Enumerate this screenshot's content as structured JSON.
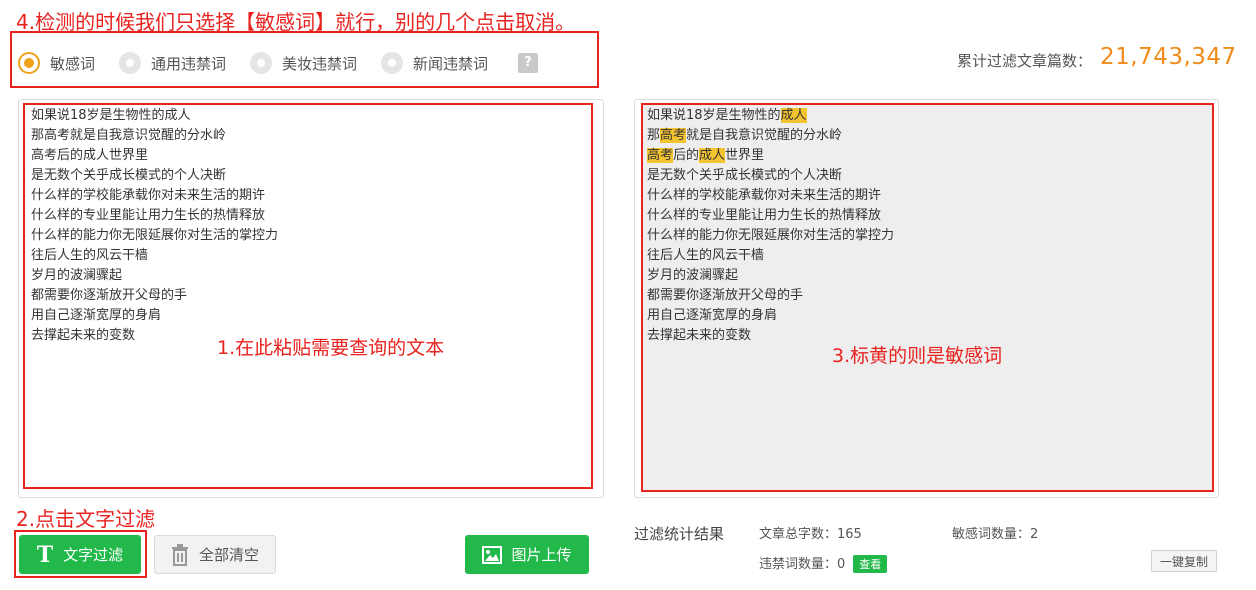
{
  "annotations": {
    "step4": "4.检测的时候我们只选择【敏感词】就行，别的几个点击取消。",
    "step1": "1.在此粘贴需要查询的文本",
    "step2": "2.点击文字过滤",
    "step3": "3.标黄的则是敏感词"
  },
  "options": [
    {
      "label": "敏感词",
      "selected": true
    },
    {
      "label": "通用违禁词",
      "selected": false
    },
    {
      "label": "美妆违禁词",
      "selected": false
    },
    {
      "label": "新闻违禁词",
      "selected": false
    }
  ],
  "help_label": "?",
  "counter": {
    "label": "累计过滤文章篇数：",
    "value": "21,743,347"
  },
  "input_lines": [
    "如果说18岁是生物性的成人",
    "那高考就是自我意识觉醒的分水岭",
    "高考后的成人世界里",
    "是无数个关乎成长模式的个人决断",
    "什么样的学校能承载你对未来生活的期许",
    "什么样的专业里能让用力生长的热情释放",
    "什么样的能力你无限延展你对生活的掌控力",
    "往后人生的风云干樯",
    "岁月的波澜骤起",
    "都需要你逐渐放开父母的手",
    "用自己逐渐宽厚的身肩",
    "去撑起未来的变数"
  ],
  "output_lines": [
    [
      {
        "t": "如果说18岁是生物性的",
        "hl": false
      },
      {
        "t": "成人",
        "hl": true
      }
    ],
    [
      {
        "t": "那",
        "hl": false
      },
      {
        "t": "高考",
        "hl": true
      },
      {
        "t": "就是自我意识觉醒的分水岭",
        "hl": false
      }
    ],
    [
      {
        "t": "高考",
        "hl": true
      },
      {
        "t": "后的",
        "hl": false
      },
      {
        "t": "成人",
        "hl": true
      },
      {
        "t": "世界里",
        "hl": false
      }
    ],
    [
      {
        "t": "是无数个关乎成长模式的个人决断",
        "hl": false
      }
    ],
    [
      {
        "t": "什么样的学校能承载你对未来生活的期许",
        "hl": false
      }
    ],
    [
      {
        "t": "什么样的专业里能让用力生长的热情释放",
        "hl": false
      }
    ],
    [
      {
        "t": "什么样的能力你无限延展你对生活的掌控力",
        "hl": false
      }
    ],
    [
      {
        "t": "往后人生的风云干樯",
        "hl": false
      }
    ],
    [
      {
        "t": "岁月的波澜骤起",
        "hl": false
      }
    ],
    [
      {
        "t": "都需要你逐渐放开父母的手",
        "hl": false
      }
    ],
    [
      {
        "t": "用自己逐渐宽厚的身肩",
        "hl": false
      }
    ],
    [
      {
        "t": "去撑起未来的变数",
        "hl": false
      }
    ]
  ],
  "buttons": {
    "filter_icon": "T",
    "filter": "文字过滤",
    "clear": "全部清空",
    "upload": "图片上传",
    "view": "查看",
    "copy": "一键复制"
  },
  "stats": {
    "title": "过滤统计结果",
    "total_chars": "文章总字数：165",
    "sensitive_count": "敏感词数量：2",
    "banned_count": "违禁词数量：0"
  },
  "colors": {
    "accent_green": "#22b94a",
    "accent_orange": "#f08c1b",
    "highlight": "#f4c430",
    "annotation_red": "#e8231f"
  }
}
